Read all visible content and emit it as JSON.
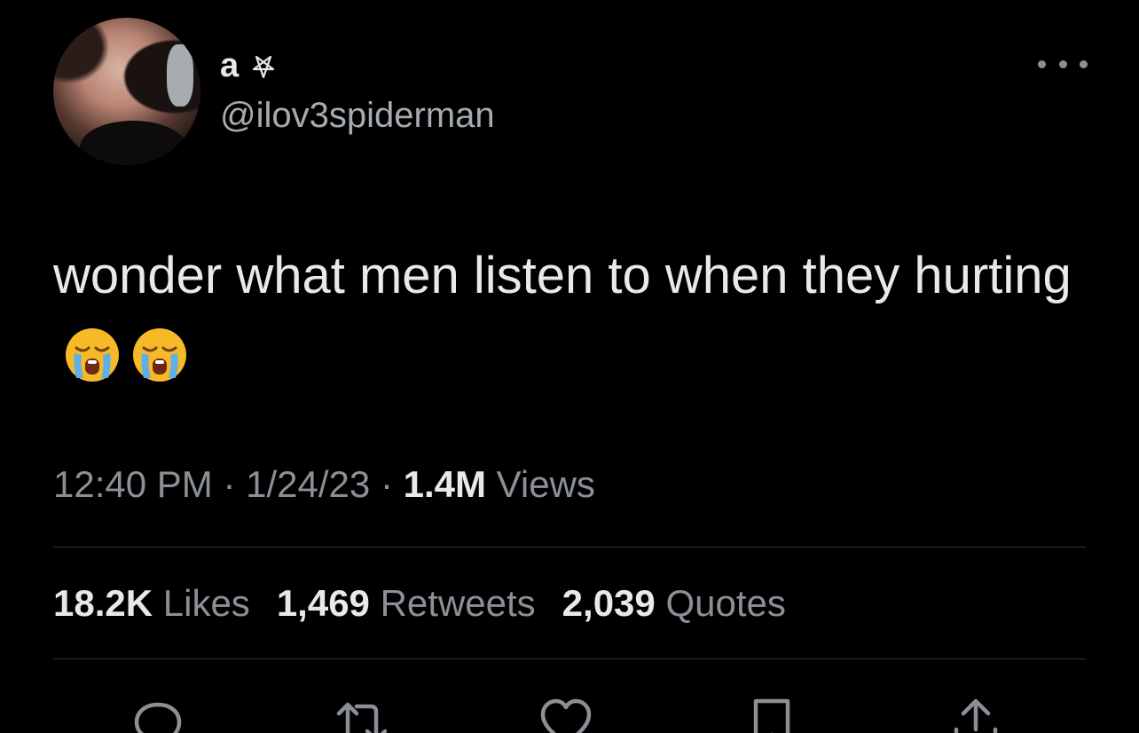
{
  "user": {
    "display_name": "a",
    "name_icon": "pentagram-icon",
    "handle": "@ilov3spiderman"
  },
  "tweet": {
    "text": "wonder what men listen to when they hurting",
    "emojis": [
      "loudly-crying-face",
      "loudly-crying-face"
    ]
  },
  "meta": {
    "time": "12:40 PM",
    "separator": "·",
    "date": "1/24/23",
    "views_count": "1.4M",
    "views_label": "Views"
  },
  "stats": {
    "likes_count": "18.2K",
    "likes_label": "Likes",
    "retweets_count": "1,469",
    "retweets_label": "Retweets",
    "quotes_count": "2,039",
    "quotes_label": "Quotes"
  },
  "actions": [
    "reply-icon",
    "retweet-icon",
    "like-icon",
    "bookmark-icon",
    "share-icon"
  ],
  "colors": {
    "background": "#000000",
    "primary_text": "#e7e9ea",
    "secondary_text": "#8b9096",
    "divider": "#2f3336"
  }
}
